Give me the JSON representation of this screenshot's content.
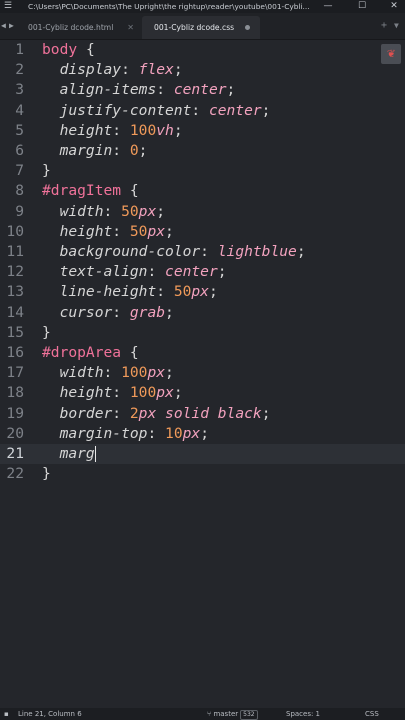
{
  "window": {
    "title": "C:\\Users\\PC\\Documents\\The Upright\\the rightup\\reader\\youtube\\001-Cybli...",
    "controls": {
      "minimize": "—",
      "maximize": "☐",
      "close": "✕"
    }
  },
  "tabs": [
    {
      "label": "001-Cybliz dcode.html",
      "active": false
    },
    {
      "label": "001-Cybliz dcode.css",
      "active": true
    }
  ],
  "editor": {
    "lines": [
      {
        "n": "1",
        "tokens": [
          [
            "sel",
            "body"
          ],
          [
            "p",
            " {"
          ]
        ]
      },
      {
        "n": "2",
        "tokens": [
          [
            "p",
            "  "
          ],
          [
            "prop",
            "display"
          ],
          [
            "p",
            ": "
          ],
          [
            "val",
            "flex"
          ],
          [
            "p",
            ";"
          ]
        ]
      },
      {
        "n": "3",
        "tokens": [
          [
            "p",
            "  "
          ],
          [
            "prop",
            "align-items"
          ],
          [
            "p",
            ": "
          ],
          [
            "val",
            "center"
          ],
          [
            "p",
            ";"
          ]
        ]
      },
      {
        "n": "4",
        "tokens": [
          [
            "p",
            "  "
          ],
          [
            "prop",
            "justify-content"
          ],
          [
            "p",
            ": "
          ],
          [
            "val",
            "center"
          ],
          [
            "p",
            ";"
          ]
        ]
      },
      {
        "n": "5",
        "tokens": [
          [
            "p",
            "  "
          ],
          [
            "prop",
            "height"
          ],
          [
            "p",
            ": "
          ],
          [
            "num",
            "100"
          ],
          [
            "unit",
            "vh"
          ],
          [
            "p",
            ";"
          ]
        ]
      },
      {
        "n": "6",
        "tokens": [
          [
            "p",
            "  "
          ],
          [
            "prop",
            "margin"
          ],
          [
            "p",
            ": "
          ],
          [
            "num",
            "0"
          ],
          [
            "p",
            ";"
          ]
        ]
      },
      {
        "n": "7",
        "tokens": [
          [
            "p",
            "}"
          ]
        ]
      },
      {
        "n": "8",
        "tokens": [
          [
            "sel",
            "#dragItem"
          ],
          [
            "p",
            " {"
          ]
        ]
      },
      {
        "n": "9",
        "tokens": [
          [
            "p",
            "  "
          ],
          [
            "prop",
            "width"
          ],
          [
            "p",
            ": "
          ],
          [
            "num",
            "50"
          ],
          [
            "unit",
            "px"
          ],
          [
            "p",
            ";"
          ]
        ]
      },
      {
        "n": "10",
        "tokens": [
          [
            "p",
            "  "
          ],
          [
            "prop",
            "height"
          ],
          [
            "p",
            ": "
          ],
          [
            "num",
            "50"
          ],
          [
            "unit",
            "px"
          ],
          [
            "p",
            ";"
          ]
        ]
      },
      {
        "n": "11",
        "tokens": [
          [
            "p",
            "  "
          ],
          [
            "prop",
            "background-color"
          ],
          [
            "p",
            ": "
          ],
          [
            "val",
            "lightblue"
          ],
          [
            "p",
            ";"
          ]
        ]
      },
      {
        "n": "12",
        "tokens": [
          [
            "p",
            "  "
          ],
          [
            "prop",
            "text-align"
          ],
          [
            "p",
            ": "
          ],
          [
            "val",
            "center"
          ],
          [
            "p",
            ";"
          ]
        ]
      },
      {
        "n": "13",
        "tokens": [
          [
            "p",
            "  "
          ],
          [
            "prop",
            "line-height"
          ],
          [
            "p",
            ": "
          ],
          [
            "num",
            "50"
          ],
          [
            "unit",
            "px"
          ],
          [
            "p",
            ";"
          ]
        ]
      },
      {
        "n": "14",
        "tokens": [
          [
            "p",
            "  "
          ],
          [
            "prop",
            "cursor"
          ],
          [
            "p",
            ": "
          ],
          [
            "val",
            "grab"
          ],
          [
            "p",
            ";"
          ]
        ]
      },
      {
        "n": "15",
        "tokens": [
          [
            "p",
            "}"
          ]
        ]
      },
      {
        "n": "16",
        "tokens": [
          [
            "sel",
            "#dropArea"
          ],
          [
            "p",
            " {"
          ]
        ]
      },
      {
        "n": "17",
        "tokens": [
          [
            "p",
            "  "
          ],
          [
            "prop",
            "width"
          ],
          [
            "p",
            ": "
          ],
          [
            "num",
            "100"
          ],
          [
            "unit",
            "px"
          ],
          [
            "p",
            ";"
          ]
        ]
      },
      {
        "n": "18",
        "tokens": [
          [
            "p",
            "  "
          ],
          [
            "prop",
            "height"
          ],
          [
            "p",
            ": "
          ],
          [
            "num",
            "100"
          ],
          [
            "unit",
            "px"
          ],
          [
            "p",
            ";"
          ]
        ]
      },
      {
        "n": "19",
        "tokens": [
          [
            "p",
            "  "
          ],
          [
            "prop",
            "border"
          ],
          [
            "p",
            ": "
          ],
          [
            "num",
            "2"
          ],
          [
            "unit",
            "px"
          ],
          [
            "p",
            " "
          ],
          [
            "val",
            "solid black"
          ],
          [
            "p",
            ";"
          ]
        ]
      },
      {
        "n": "20",
        "tokens": [
          [
            "p",
            "  "
          ],
          [
            "prop",
            "margin-top"
          ],
          [
            "p",
            ": "
          ],
          [
            "num",
            "10"
          ],
          [
            "unit",
            "px"
          ],
          [
            "p",
            ";"
          ]
        ]
      },
      {
        "n": "21",
        "tokens": [
          [
            "p",
            "  "
          ],
          [
            "prop",
            "marg"
          ]
        ],
        "active": true
      },
      {
        "n": "22",
        "tokens": [
          [
            "p",
            "}"
          ]
        ]
      }
    ]
  },
  "icons": {
    "menu": "hamburger-icon",
    "minimap": "minimap-toggle-icon"
  },
  "status": {
    "position": "Line 21, Column 6",
    "branch": "master",
    "branch_count": "532",
    "spaces": "Spaces: 1",
    "syntax": "CSS"
  },
  "colors": {
    "selector": "#f0729a",
    "value": "#f2a2be",
    "number": "#f09a5a",
    "background": "#24262b"
  }
}
